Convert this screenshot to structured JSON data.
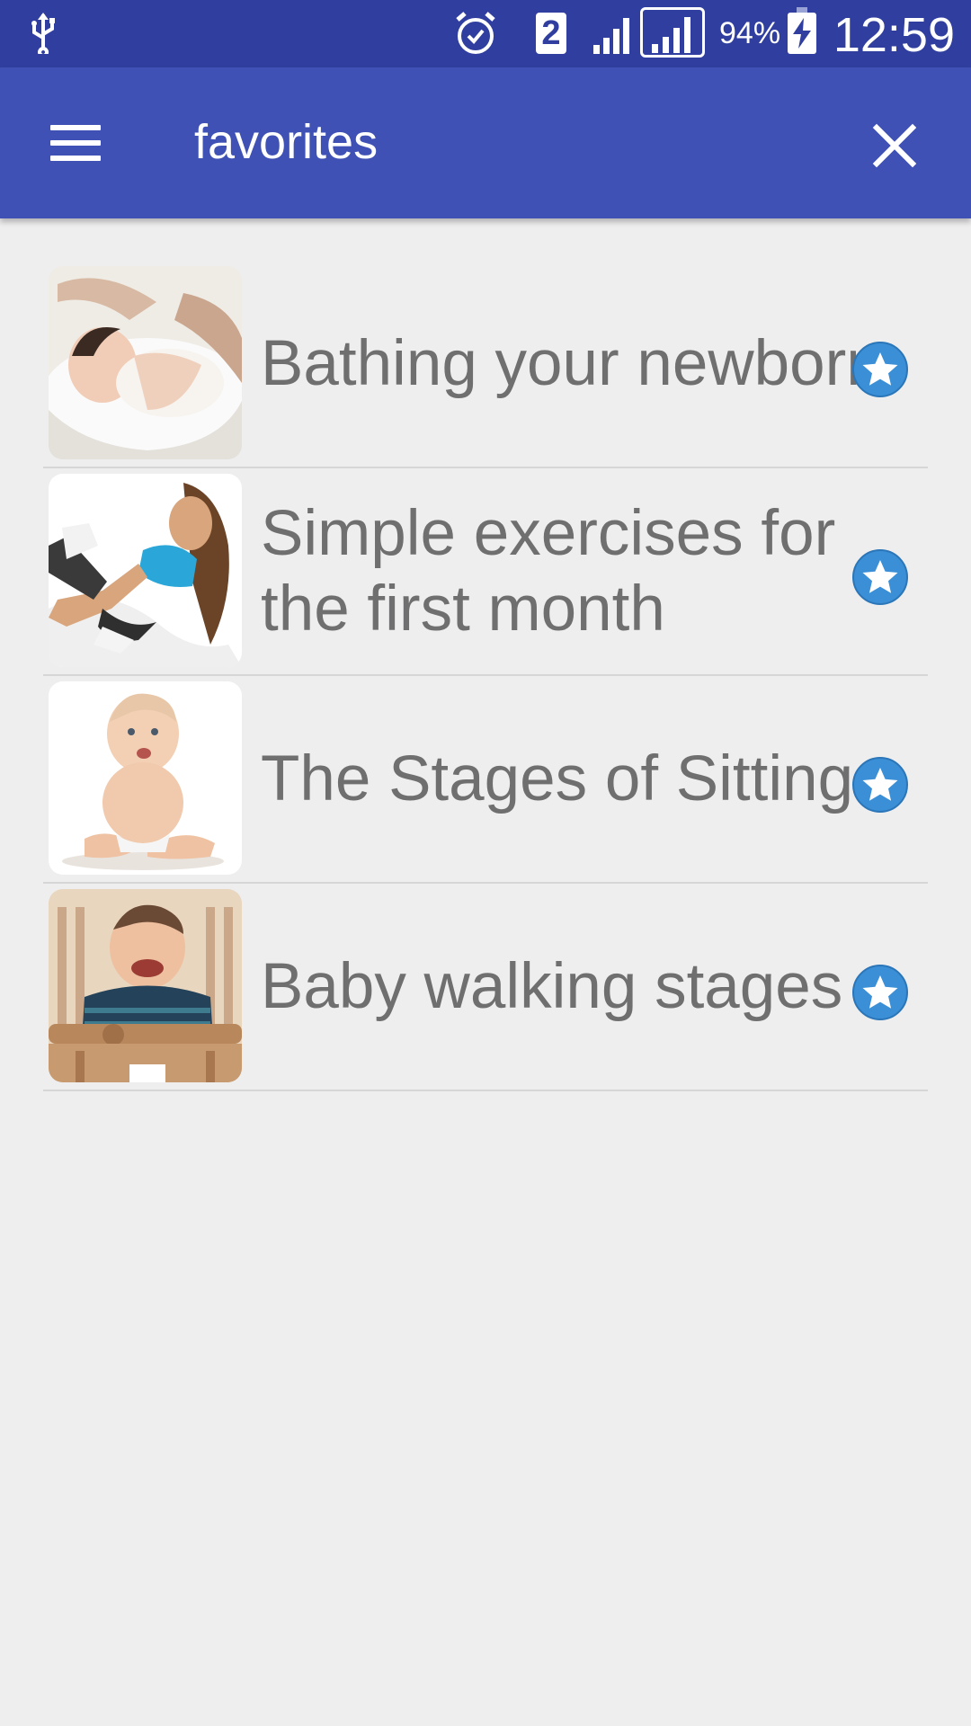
{
  "status_bar": {
    "battery_percent": "94%",
    "time": "12:59",
    "sim_slot": "2",
    "icons": [
      "usb-icon",
      "alarm-icon",
      "sim-2-icon",
      "signal-icon",
      "signal-icon",
      "battery-charging-icon"
    ]
  },
  "app_bar": {
    "title": "favorites",
    "menu_icon": "hamburger-menu-icon",
    "close_icon": "close-icon",
    "color": "#3f51b5"
  },
  "favorites": [
    {
      "title": "Bathing your newborn",
      "image": "baby-bath-photo",
      "starred": true
    },
    {
      "title": "Simple exercises for the first month",
      "image": "woman-exercise-photo",
      "starred": true
    },
    {
      "title": "The Stages of Sitting",
      "image": "sitting-baby-photo",
      "starred": true
    },
    {
      "title": "Baby walking stages",
      "image": "baby-crib-photo",
      "starred": true
    }
  ],
  "star_color": "#3a8fd6"
}
